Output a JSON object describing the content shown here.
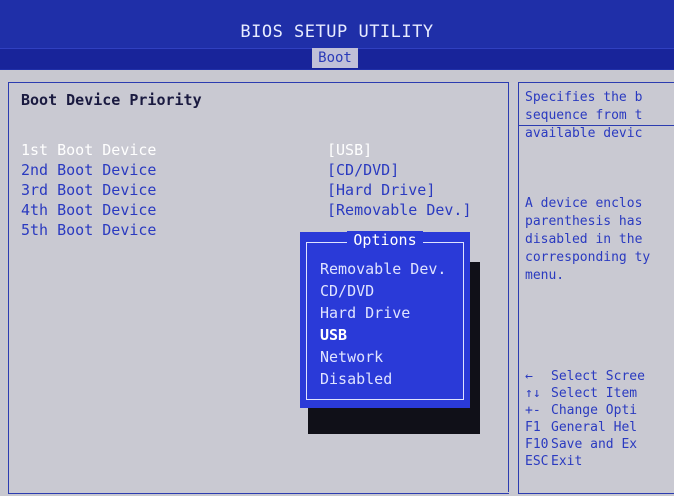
{
  "header": {
    "title": "BIOS SETUP UTILITY",
    "active_tab": "Boot"
  },
  "main": {
    "section_title": "Boot Device Priority",
    "rows": [
      {
        "label": "1st Boot Device",
        "value": "[USB]"
      },
      {
        "label": "2nd Boot Device",
        "value": "[CD/DVD]"
      },
      {
        "label": "3rd Boot Device",
        "value": "[Hard Drive]"
      },
      {
        "label": "4th Boot Device",
        "value": "[Removable Dev.]"
      },
      {
        "label": "5th Boot Device",
        "value": ""
      }
    ]
  },
  "popup": {
    "title": "Options",
    "options": [
      "Removable Dev.",
      "CD/DVD",
      "Hard Drive",
      "USB",
      "Network",
      "Disabled"
    ],
    "selected": "USB"
  },
  "help": {
    "lines": [
      "Specifies the b",
      "sequence from t",
      "available devic",
      "",
      "A device enclos",
      "parenthesis has",
      "disabled in the",
      "corresponding ty",
      "menu."
    ],
    "keys": [
      {
        "key": "←",
        "desc": "Select Scree"
      },
      {
        "key": "↑↓",
        "desc": "Select Item"
      },
      {
        "key": "+-",
        "desc": "Change Opti"
      },
      {
        "key": "F1",
        "desc": "General Hel"
      },
      {
        "key": "F10",
        "desc": "Save and Ex"
      },
      {
        "key": "ESC",
        "desc": "Exit"
      }
    ]
  }
}
